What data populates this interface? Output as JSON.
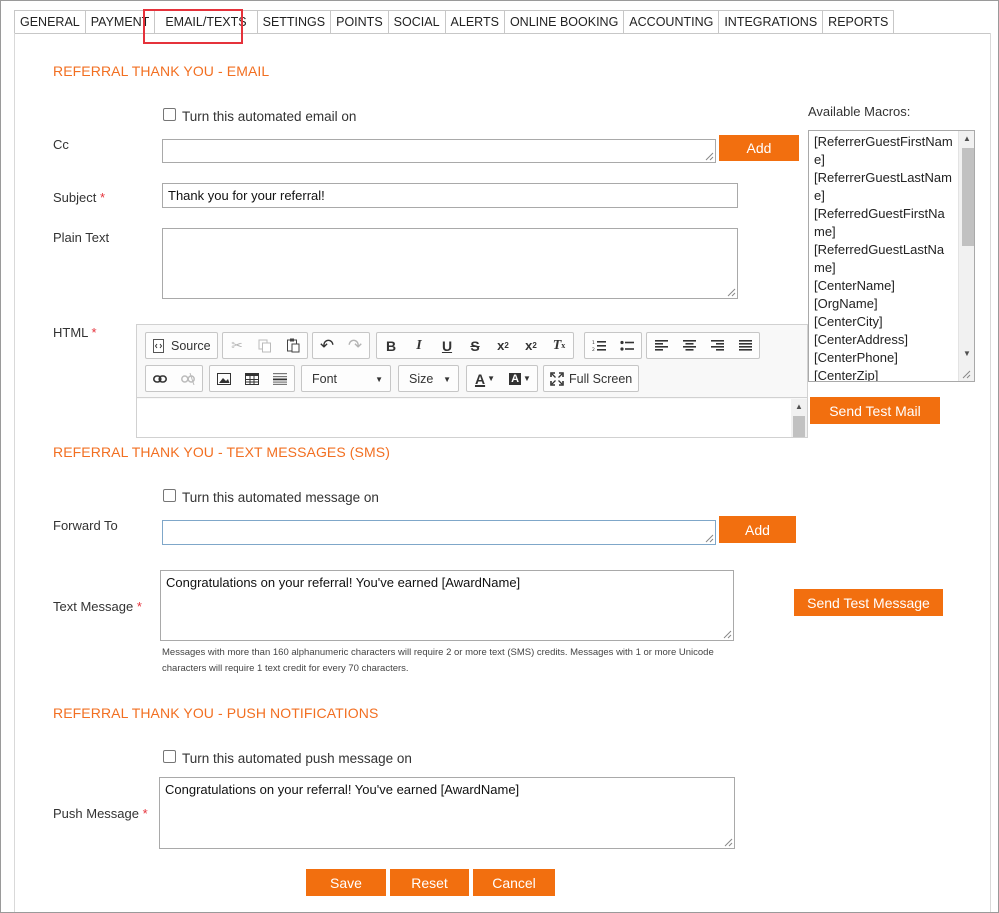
{
  "tabs": [
    {
      "label": "GENERAL"
    },
    {
      "label": "PAYMENT"
    },
    {
      "label": "EMAIL/TEXTS",
      "active": true
    },
    {
      "label": "SETTINGS"
    },
    {
      "label": "POINTS"
    },
    {
      "label": "SOCIAL"
    },
    {
      "label": "ALERTS"
    },
    {
      "label": "ONLINE BOOKING"
    },
    {
      "label": "ACCOUNTING"
    },
    {
      "label": "INTEGRATIONS"
    },
    {
      "label": "REPORTS"
    }
  ],
  "colors": {
    "accent": "#f26f0f",
    "section_title": "#f26f21",
    "required": "#e5323b",
    "active_tab_highlight": "#e5323b"
  },
  "email": {
    "title": "REFERRAL THANK YOU - EMAIL",
    "toggle_label": "Turn this automated email on",
    "cc_label": "Cc",
    "cc_value": "",
    "add_label": "Add",
    "subject_label": "Subject",
    "subject_value": "Thank you for your referral!",
    "plain_text_label": "Plain Text",
    "plain_text_value": "",
    "html_label": "HTML",
    "send_test_label": "Send Test Mail"
  },
  "required_mark": "*",
  "macros": {
    "title": "Available Macros:",
    "items": [
      "[ReferrerGuestFirstName]",
      "[ReferrerGuestLastName]",
      "[ReferredGuestFirstName]",
      "[ReferredGuestLastName]",
      "[CenterName]",
      "[OrgName]",
      "[CenterCity]",
      "[CenterAddress]",
      "[CenterPhone]",
      "[CenterZip]"
    ]
  },
  "editor": {
    "source_label": "Source",
    "font_label": "Font",
    "size_label": "Size",
    "fullscreen_label": "Full Screen",
    "icons": [
      "source-icon",
      "cut-icon",
      "copy-icon",
      "paste-icon",
      "undo-icon",
      "redo-icon",
      "bold-icon",
      "italic-icon",
      "underline-icon",
      "strikethrough-icon",
      "subscript-icon",
      "superscript-icon",
      "remove-format-icon",
      "numbered-list-icon",
      "bulleted-list-icon",
      "align-left-icon",
      "align-center-icon",
      "align-right-icon",
      "justify-icon",
      "link-icon",
      "unlink-icon",
      "image-icon",
      "table-icon",
      "horizontal-line-icon",
      "text-color-icon",
      "background-color-icon",
      "fullscreen-icon"
    ]
  },
  "sms": {
    "title": "REFERRAL THANK YOU - TEXT MESSAGES (SMS)",
    "toggle_label": "Turn this automated message on",
    "forward_label": "Forward To",
    "forward_value": "",
    "add_label": "Add",
    "message_label": "Text Message",
    "message_value": "Congratulations on your referral! You've earned [AwardName]",
    "send_test_label": "Send Test Message",
    "hint": "Messages with more than 160 alphanumeric characters will require 2 or more text (SMS) credits. Messages with 1 or more Unicode characters will require 1 text credit for every 70 characters."
  },
  "push": {
    "title": "REFERRAL THANK YOU - PUSH NOTIFICATIONS",
    "toggle_label": "Turn this automated push message on",
    "message_label": "Push Message",
    "message_value": "Congratulations on your referral! You've earned [AwardName]"
  },
  "actions": {
    "save": "Save",
    "reset": "Reset",
    "cancel": "Cancel"
  }
}
